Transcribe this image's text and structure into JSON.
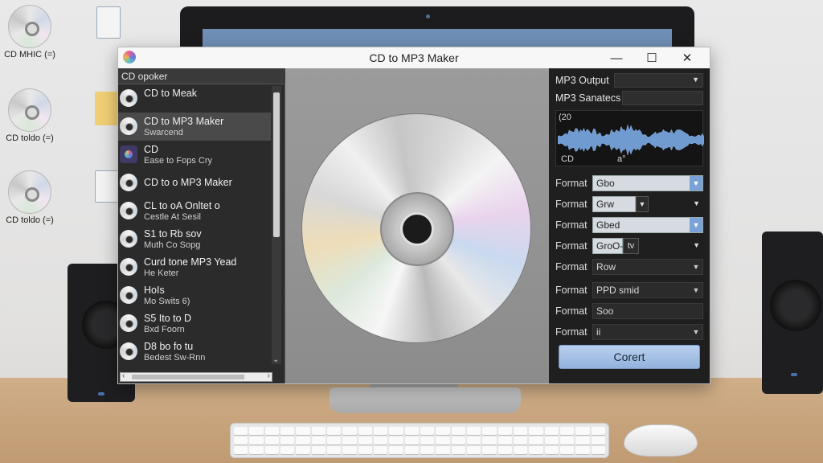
{
  "window": {
    "title": "CD to MP3 Maker",
    "controls": {
      "minimize": "—",
      "maximize": "☐",
      "close": "✕"
    }
  },
  "desktop": {
    "icons": [
      {
        "label": "CD MHIC (=)"
      },
      {
        "label": "CD toldo (=)"
      },
      {
        "label": "CD toldo (=)"
      }
    ]
  },
  "left_panel": {
    "header": "CD opoker",
    "tracks": [
      {
        "line1": "CD to Meak",
        "line2": "",
        "icon": "cd"
      },
      {
        "line1": "CD to MP3 Maker",
        "line2": "Swarcend",
        "icon": "cd",
        "selected": true
      },
      {
        "line1": "CD",
        "line2": "Ease to Fops Cry",
        "icon": "app"
      },
      {
        "line1": "CD to o MP3 Maker",
        "line2": "",
        "icon": "cd"
      },
      {
        "line1": "CL to oA Onltet o",
        "line2": "Cestle At Sesil",
        "icon": "cd"
      },
      {
        "line1": "S1 to Rb sov",
        "line2": "Muth Co Sopg",
        "icon": "cd"
      },
      {
        "line1": "Curd tone MP3 Yead",
        "line2": "He Keter",
        "icon": "cd"
      },
      {
        "line1": "HoIs",
        "line2": "Mo Swits 6)",
        "icon": "cd"
      },
      {
        "line1": "S5 Ito to D",
        "line2": "Bxd Foorn",
        "icon": "cd"
      },
      {
        "line1": "D8 bo fo tu",
        "line2": "Bedest Sw-Rnn",
        "icon": "cd"
      }
    ]
  },
  "right_panel": {
    "output_label": "MP3 Output",
    "sample_rate_label": "MP3 Sanatecs",
    "wave_top_label": "(20",
    "wave_bottom_left": "CD",
    "wave_bottom_mid": "a°",
    "formats": [
      {
        "label": "Format",
        "value": "Gbo",
        "style": "light"
      },
      {
        "label": "Format",
        "value": "Grw",
        "style": "split"
      },
      {
        "label": "Format",
        "value": "Gbed",
        "style": "light"
      },
      {
        "label": "Format",
        "value": "GroO-",
        "value2": "tv",
        "style": "split2"
      },
      {
        "label": "Format",
        "value": "Row",
        "style": "dark"
      },
      {
        "label": "Format",
        "value": "PPD smid",
        "style": "dark"
      },
      {
        "label": "Format",
        "value": "Soo",
        "style": "dark-noarrow"
      },
      {
        "label": "Format",
        "value": "ii",
        "style": "dark"
      }
    ],
    "convert_label": "Corert"
  },
  "colors": {
    "accent": "#93b2dd",
    "panel_dark": "#1f1f1f",
    "list_bg": "#2b2b2b"
  }
}
